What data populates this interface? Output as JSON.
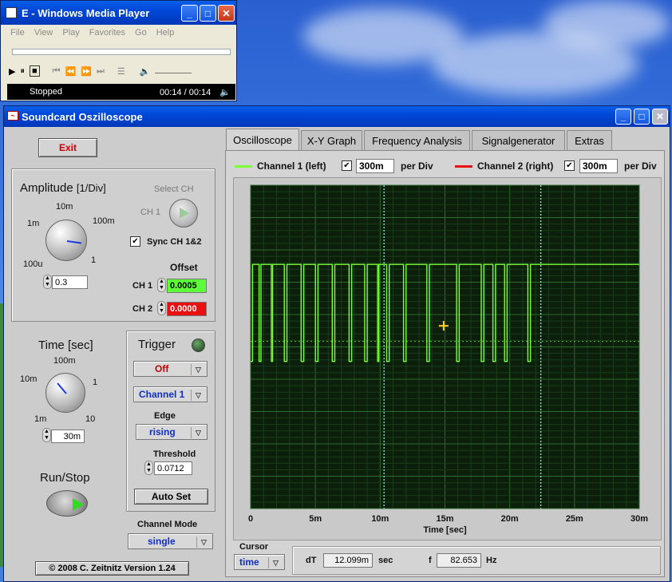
{
  "wmp": {
    "title": "E - Windows Media Player",
    "menu": [
      "File",
      "View",
      "Play",
      "Favorites",
      "Go",
      "Help"
    ],
    "status": "Stopped",
    "time": "00:14 / 00:14"
  },
  "osc": {
    "title": "Soundcard Oszilloscope",
    "exit_label": "Exit",
    "amplitude": {
      "title": "Amplitude",
      "unit": "[1/Div]",
      "scale": [
        "10m",
        "1m",
        "100m",
        "100u",
        "1"
      ],
      "value": "0.3"
    },
    "select_ch": {
      "title": "Select CH",
      "value": "CH 1"
    },
    "sync": {
      "label": "Sync CH 1&2",
      "checked": true
    },
    "offset": {
      "title": "Offset",
      "ch1_label": "CH 1",
      "ch1_value": "0.0005",
      "ch2_label": "CH 2",
      "ch2_value": "0.0000"
    },
    "time": {
      "title": "Time [sec]",
      "scale": [
        "100m",
        "10m",
        "1",
        "1m",
        "10"
      ],
      "value": "30m"
    },
    "trigger": {
      "title": "Trigger",
      "mode": "Off",
      "channel": "Channel 1",
      "edge_label": "Edge",
      "edge": "rising",
      "threshold_label": "Threshold",
      "threshold": "0.0712",
      "autoset_label": "Auto Set"
    },
    "run_stop_label": "Run/Stop",
    "channel_mode": {
      "label": "Channel Mode",
      "value": "single"
    },
    "copyright": "© 2008  C. Zeitnitz Version 1.24",
    "tabs": [
      "Oscilloscope",
      "X-Y Graph",
      "Frequency Analysis",
      "Signalgenerator",
      "Extras"
    ],
    "legend": {
      "ch1": "Channel 1 (left)",
      "ch1_div": "300m",
      "ch2": "Channel 2 (right)",
      "ch2_div": "300m",
      "per_div": "per Div"
    },
    "cursor": {
      "label": "Cursor",
      "mode": "time",
      "dT_label": "dT",
      "dT_value": "12.099m",
      "dT_unit": "sec",
      "f_label": "f",
      "f_value": "82.653",
      "f_unit": "Hz"
    }
  },
  "chart_data": {
    "type": "line",
    "xlabel": "Time [sec]",
    "x_ticks": [
      "0",
      "5m",
      "10m",
      "15m",
      "20m",
      "25m",
      "30m"
    ],
    "xlim": [
      0,
      0.03
    ],
    "ylim": [
      -5,
      5
    ],
    "grid": true,
    "cursors_x": [
      0.0103,
      0.0224
    ],
    "trigger_level_y": 0.0712,
    "series": [
      {
        "name": "Channel 1 (left)",
        "color": "#7cff3a",
        "x": [
          0,
          0.00015,
          0.00015,
          0.00065,
          0.00065,
          0.0008,
          0.0008,
          0.0016,
          0.0016,
          0.0017,
          0.0017,
          0.0026,
          0.0026,
          0.0028,
          0.0028,
          0.0039,
          0.0039,
          0.0041,
          0.0041,
          0.005,
          0.005,
          0.0052,
          0.0052,
          0.0063,
          0.0063,
          0.0065,
          0.0065,
          0.0076,
          0.0076,
          0.0078,
          0.0078,
          0.0088,
          0.0088,
          0.009,
          0.009,
          0.0098,
          0.0098,
          0.0099,
          0.0099,
          0.0105,
          0.0105,
          0.0107,
          0.0107,
          0.0118,
          0.0118,
          0.012,
          0.012,
          0.0136,
          0.0136,
          0.0138,
          0.0138,
          0.0159,
          0.0159,
          0.0161,
          0.0161,
          0.0178,
          0.0178,
          0.018,
          0.018,
          0.0187,
          0.0187,
          0.0189,
          0.0189,
          0.0196,
          0.0196,
          0.0198,
          0.0198,
          0.0214,
          0.0214,
          0.0216,
          0.0216,
          0.0235,
          0.0235,
          0.03
        ],
        "y": [
          -0.45,
          -0.45,
          2.55,
          2.55,
          -0.45,
          -0.45,
          2.55,
          2.55,
          -0.45,
          -0.45,
          2.55,
          2.55,
          -0.45,
          -0.45,
          2.55,
          2.55,
          -0.45,
          -0.45,
          2.55,
          2.55,
          -0.45,
          -0.45,
          2.55,
          2.55,
          -0.45,
          -0.45,
          2.55,
          2.55,
          -0.45,
          -0.45,
          2.55,
          2.55,
          -0.45,
          -0.45,
          2.55,
          2.55,
          -0.45,
          -0.45,
          2.55,
          2.55,
          -0.45,
          -0.45,
          2.55,
          2.55,
          -0.45,
          -0.45,
          2.55,
          2.55,
          -0.45,
          -0.45,
          2.55,
          2.55,
          -0.45,
          -0.45,
          2.55,
          2.55,
          -0.45,
          -0.45,
          2.55,
          2.55,
          -0.45,
          -0.45,
          2.55,
          2.55,
          -0.45,
          -0.45,
          2.55,
          2.55,
          -0.45,
          -0.45,
          2.55,
          2.55,
          2.55,
          2.55
        ]
      }
    ]
  }
}
